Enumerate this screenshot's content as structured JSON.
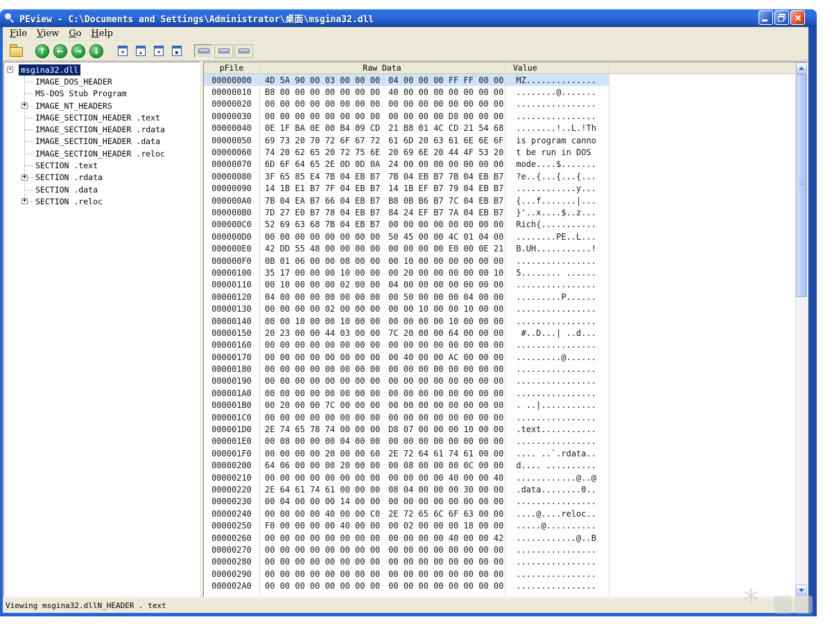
{
  "window": {
    "title": "PEview - C:\\Documents and Settings\\Administrator\\桌面\\msgina32.dll",
    "status": "Viewing msgina32.dllN_HEADER . text"
  },
  "colors": {
    "titlebar": "#2E6BDD",
    "tree_selection": "#0A246A",
    "row_highlight": "#CFE3F6",
    "chrome": "#ECE9D8"
  },
  "menu": {
    "items": [
      {
        "label": "File"
      },
      {
        "label": "View"
      },
      {
        "label": "Go"
      },
      {
        "label": "Help"
      }
    ]
  },
  "toolbar": {
    "buttons": [
      {
        "name": "open-file",
        "type": "folder"
      },
      {
        "name": "go-up",
        "type": "nav",
        "glyph": "↑",
        "gap": true
      },
      {
        "name": "go-back",
        "type": "nav",
        "glyph": "←"
      },
      {
        "name": "go-forward",
        "type": "nav",
        "glyph": "→"
      },
      {
        "name": "go-down",
        "type": "nav",
        "glyph": "↓"
      },
      {
        "name": "view-expand",
        "type": "view",
        "glyph": "▾",
        "gap": true
      },
      {
        "name": "view-collapse",
        "type": "view",
        "glyph": "▴"
      },
      {
        "name": "view-next",
        "type": "view",
        "glyph": "▾"
      },
      {
        "name": "view-item",
        "type": "view",
        "glyph": "▪"
      },
      {
        "name": "mode-byte",
        "type": "mode",
        "pressed": true,
        "gap": true
      },
      {
        "name": "mode-word",
        "type": "mode"
      },
      {
        "name": "mode-dword",
        "type": "mode"
      }
    ]
  },
  "tree": {
    "items": [
      {
        "label": "msgina32.dll",
        "glyph": "-",
        "indent": 0,
        "selected": true
      },
      {
        "label": "IMAGE_DOS_HEADER",
        "glyph": "",
        "indent": 1
      },
      {
        "label": "MS-DOS Stub Program",
        "glyph": "",
        "indent": 1
      },
      {
        "label": "IMAGE_NT_HEADERS",
        "glyph": "+",
        "indent": 1
      },
      {
        "label": "IMAGE_SECTION_HEADER .text",
        "glyph": "",
        "indent": 1
      },
      {
        "label": "IMAGE_SECTION_HEADER .rdata",
        "glyph": "",
        "indent": 1
      },
      {
        "label": "IMAGE_SECTION_HEADER .data",
        "glyph": "",
        "indent": 1
      },
      {
        "label": "IMAGE_SECTION_HEADER .reloc",
        "glyph": "",
        "indent": 1
      },
      {
        "label": "SECTION .text",
        "glyph": "",
        "indent": 1
      },
      {
        "label": "SECTION .rdata",
        "glyph": "+",
        "indent": 1
      },
      {
        "label": "SECTION .data",
        "glyph": "",
        "indent": 1
      },
      {
        "label": "SECTION .reloc",
        "glyph": "+",
        "indent": 1
      }
    ]
  },
  "hex": {
    "columns": [
      "pFile",
      "Raw Data",
      "Value"
    ],
    "rows": [
      {
        "o": "00000000",
        "a": "4D 5A 90 00 03 00 00 00",
        "b": "04 00 00 00 FF FF 00 00",
        "v": "MZ.............."
      },
      {
        "o": "00000010",
        "a": "B8 00 00 00 00 00 00 00",
        "b": "40 00 00 00 00 00 00 00",
        "v": "........@......."
      },
      {
        "o": "00000020",
        "a": "00 00 00 00 00 00 00 00",
        "b": "00 00 00 00 00 00 00 00",
        "v": "................"
      },
      {
        "o": "00000030",
        "a": "00 00 00 00 00 00 00 00",
        "b": "00 00 00 00 D8 00 00 00",
        "v": "................"
      },
      {
        "o": "00000040",
        "a": "0E 1F BA 0E 00 B4 09 CD",
        "b": "21 B8 01 4C CD 21 54 68",
        "v": "........!..L.!Th"
      },
      {
        "o": "00000050",
        "a": "69 73 20 70 72 6F 67 72",
        "b": "61 6D 20 63 61 6E 6E 6F",
        "v": "is program canno"
      },
      {
        "o": "00000060",
        "a": "74 20 62 65 20 72 75 6E",
        "b": "20 69 6E 20 44 4F 53 20",
        "v": "t be run in DOS "
      },
      {
        "o": "00000070",
        "a": "6D 6F 64 65 2E 0D 0D 0A",
        "b": "24 00 00 00 00 00 00 00",
        "v": "mode....$......."
      },
      {
        "o": "00000080",
        "a": "3F 65 85 E4 7B 04 EB B7",
        "b": "7B 04 EB B7 7B 04 EB B7",
        "v": "?e..{...{...{..."
      },
      {
        "o": "00000090",
        "a": "14 1B E1 B7 7F 04 EB B7",
        "b": "14 1B EF B7 79 04 EB B7",
        "v": "............y..."
      },
      {
        "o": "000000A0",
        "a": "7B 04 EA B7 66 04 EB B7",
        "b": "B8 0B B6 B7 7C 04 EB B7",
        "v": "{...f.......|..."
      },
      {
        "o": "000000B0",
        "a": "7D 27 E0 B7 78 04 EB B7",
        "b": "84 24 EF B7 7A 04 EB B7",
        "v": "}'..x....$..z..."
      },
      {
        "o": "000000C0",
        "a": "52 69 63 68 7B 04 EB B7",
        "b": "00 00 00 00 00 00 00 00",
        "v": "Rich{..........."
      },
      {
        "o": "000000D0",
        "a": "00 00 00 00 00 00 00 00",
        "b": "50 45 00 00 4C 01 04 00",
        "v": "........PE..L..."
      },
      {
        "o": "000000E0",
        "a": "42 DD 55 48 00 00 00 00",
        "b": "00 00 00 00 E0 00 0E 21",
        "v": "B.UH...........!"
      },
      {
        "o": "000000F0",
        "a": "0B 01 06 00 00 08 00 00",
        "b": "00 10 00 00 00 00 00 00",
        "v": "................"
      },
      {
        "o": "00000100",
        "a": "35 17 00 00 00 10 00 00",
        "b": "00 20 00 00 00 00 00 10",
        "v": "5........ ......"
      },
      {
        "o": "00000110",
        "a": "00 10 00 00 00 02 00 00",
        "b": "04 00 00 00 00 00 00 00",
        "v": "................"
      },
      {
        "o": "00000120",
        "a": "04 00 00 00 00 00 00 00",
        "b": "00 50 00 00 00 04 00 00",
        "v": ".........P......"
      },
      {
        "o": "00000130",
        "a": "00 00 00 00 02 00 00 00",
        "b": "00 00 10 00 00 10 00 00",
        "v": "................"
      },
      {
        "o": "00000140",
        "a": "00 00 10 00 00 10 00 00",
        "b": "00 00 00 00 10 00 00 00",
        "v": "................"
      },
      {
        "o": "00000150",
        "a": "20 23 00 00 44 03 00 00",
        "b": "7C 20 00 00 64 00 00 00",
        "v": " #..D...| ..d..."
      },
      {
        "o": "00000160",
        "a": "00 00 00 00 00 00 00 00",
        "b": "00 00 00 00 00 00 00 00",
        "v": "................"
      },
      {
        "o": "00000170",
        "a": "00 00 00 00 00 00 00 00",
        "b": "00 40 00 00 AC 00 00 00",
        "v": ".........@......"
      },
      {
        "o": "00000180",
        "a": "00 00 00 00 00 00 00 00",
        "b": "00 00 00 00 00 00 00 00",
        "v": "................"
      },
      {
        "o": "00000190",
        "a": "00 00 00 00 00 00 00 00",
        "b": "00 00 00 00 00 00 00 00",
        "v": "................"
      },
      {
        "o": "000001A0",
        "a": "00 00 00 00 00 00 00 00",
        "b": "00 00 00 00 00 00 00 00",
        "v": "................"
      },
      {
        "o": "000001B0",
        "a": "00 20 00 00 7C 00 00 00",
        "b": "00 00 00 00 00 00 00 00",
        "v": ". ..|..........."
      },
      {
        "o": "000001C0",
        "a": "00 00 00 00 00 00 00 00",
        "b": "00 00 00 00 00 00 00 00",
        "v": "................"
      },
      {
        "o": "000001D0",
        "a": "2E 74 65 78 74 00 00 00",
        "b": "D8 07 00 00 00 10 00 00",
        "v": ".text..........."
      },
      {
        "o": "000001E0",
        "a": "00 08 00 00 00 04 00 00",
        "b": "00 00 00 00 00 00 00 00",
        "v": "................"
      },
      {
        "o": "000001F0",
        "a": "00 00 00 00 20 00 00 60",
        "b": "2E 72 64 61 74 61 00 00",
        "v": ".... ..`.rdata.."
      },
      {
        "o": "00000200",
        "a": "64 06 00 00 00 20 00 00",
        "b": "00 08 00 00 00 0C 00 00",
        "v": "d.... .........."
      },
      {
        "o": "00000210",
        "a": "00 00 00 00 00 00 00 00",
        "b": "00 00 00 00 40 00 00 40",
        "v": "............@..@"
      },
      {
        "o": "00000220",
        "a": "2E 64 61 74 61 00 00 00",
        "b": "08 04 00 00 00 30 00 00",
        "v": ".data........0.."
      },
      {
        "o": "00000230",
        "a": "00 04 00 00 00 14 00 00",
        "b": "00 00 00 00 00 00 00 00",
        "v": "................"
      },
      {
        "o": "00000240",
        "a": "00 00 00 00 40 00 00 C0",
        "b": "2E 72 65 6C 6F 63 00 00",
        "v": "....@....reloc.."
      },
      {
        "o": "00000250",
        "a": "F0 00 00 00 00 40 00 00",
        "b": "00 02 00 00 00 18 00 00",
        "v": ".....@.........."
      },
      {
        "o": "00000260",
        "a": "00 00 00 00 00 00 00 00",
        "b": "00 00 00 00 40 00 00 42",
        "v": "............@..B"
      },
      {
        "o": "00000270",
        "a": "00 00 00 00 00 00 00 00",
        "b": "00 00 00 00 00 00 00 00",
        "v": "................"
      },
      {
        "o": "00000280",
        "a": "00 00 00 00 00 00 00 00",
        "b": "00 00 00 00 00 00 00 00",
        "v": "................"
      },
      {
        "o": "00000290",
        "a": "00 00 00 00 00 00 00 00",
        "b": "00 00 00 00 00 00 00 00",
        "v": "................"
      },
      {
        "o": "000002A0",
        "a": "00 00 00 00 00 00 00 00",
        "b": "00 00 00 00 00 00 00 00",
        "v": "................"
      }
    ]
  },
  "watermark": {
    "icon": "asterisk-logo"
  }
}
